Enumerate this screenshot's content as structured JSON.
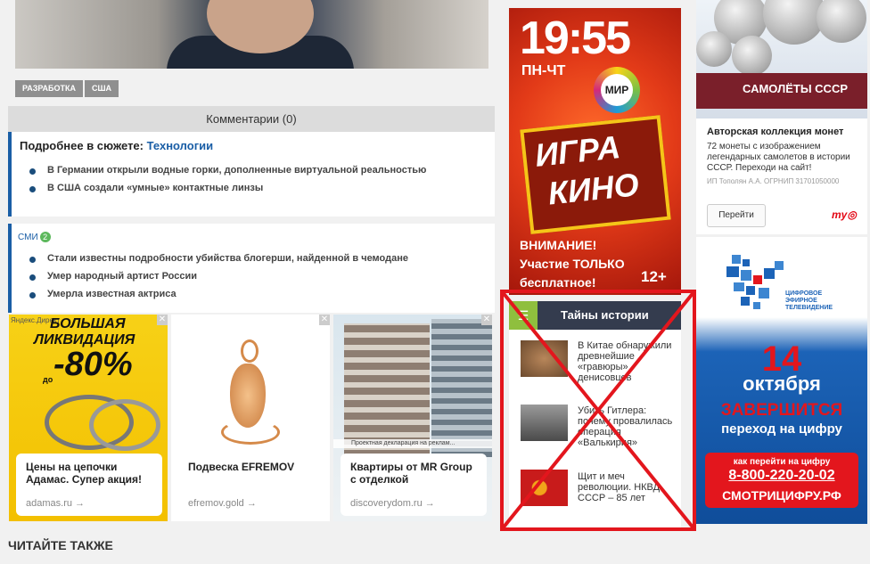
{
  "article": {
    "tags": [
      "РАЗРАБОТКА",
      "США"
    ],
    "comments_label": "Комментарии (0)"
  },
  "story": {
    "prefix": "Подробнее в сюжете:",
    "topic": "Технологии",
    "items": [
      "В Германии открыли водные горки, дополненные виртуальной реальностью",
      "В США создали «умные» контактные линзы"
    ]
  },
  "smi": {
    "label": "СМИ",
    "badge": "2",
    "items": [
      "Стали известны подробности убийства блогерши, найденной в чемодане",
      "Умер народный артист России",
      "Умерла известная актриса"
    ]
  },
  "ads": [
    {
      "title": "Цены на цепочки Адамас. Супер акция!",
      "domain": "adamas.ru",
      "overlay": "Яндекс.Директ",
      "promo1": "БОЛЬШАЯ",
      "promo2": "ЛИКВИДАЦИЯ",
      "promo_prefix": "до",
      "promo_value": "-80%"
    },
    {
      "title": "Подвеска EFREMOV",
      "domain": "efremov.gold"
    },
    {
      "title": "Квартиры от MR Group с отделкой",
      "domain": "discoverydom.ru",
      "overlay": "Проектная декларация на реклам..."
    }
  ],
  "read_also": "ЧИТАЙТЕ ТАКЖЕ",
  "mir_ad": {
    "time": "19:55",
    "days": "ПН-ЧТ",
    "channel": "МИР",
    "show1": "ИГРА",
    "show2": "КИНО",
    "warning": [
      "ВНИМАНИЕ!",
      "Участие ТОЛЬКО",
      "бесплатное!"
    ],
    "age": "12+"
  },
  "history_widget": {
    "title": "Тайны истории",
    "items": [
      "В Китае обнаружили древнейшие «гравюры» денисовцев",
      "Убить Гитлера: почему провалилась операция «Валькирия»",
      "Щит и меч революции. НКВД СССР – 85 лет"
    ]
  },
  "coins_ad": {
    "banner": "САМОЛЁТЫ СССР",
    "title": "Авторская коллекция монет",
    "description": "72 монеты с изображением легендарных самолетов в истории СССР. Переходи на сайт!",
    "legal": "ИП Тополян А.А. ОГРНИП 31701050000",
    "button": "Перейти",
    "brand": "mytarget"
  },
  "tv_ad": {
    "logo_text": [
      "ЦИФРОВОЕ",
      "ЭФИРНОЕ",
      "ТЕЛЕВИДЕНИЕ"
    ],
    "day": "14",
    "month": "октября",
    "ends": "ЗАВЕРШИТСЯ",
    "digital": "переход на цифру",
    "how": "как перейти на цифру",
    "phone": "8-800-220-20-02",
    "site": "СМОТРИЦИФРУ.РФ"
  },
  "colors": {
    "accent_blue": "#1a5ea6",
    "cross_red": "#e3161d",
    "history_green": "#8fbf3e",
    "history_header": "#343c4e"
  }
}
